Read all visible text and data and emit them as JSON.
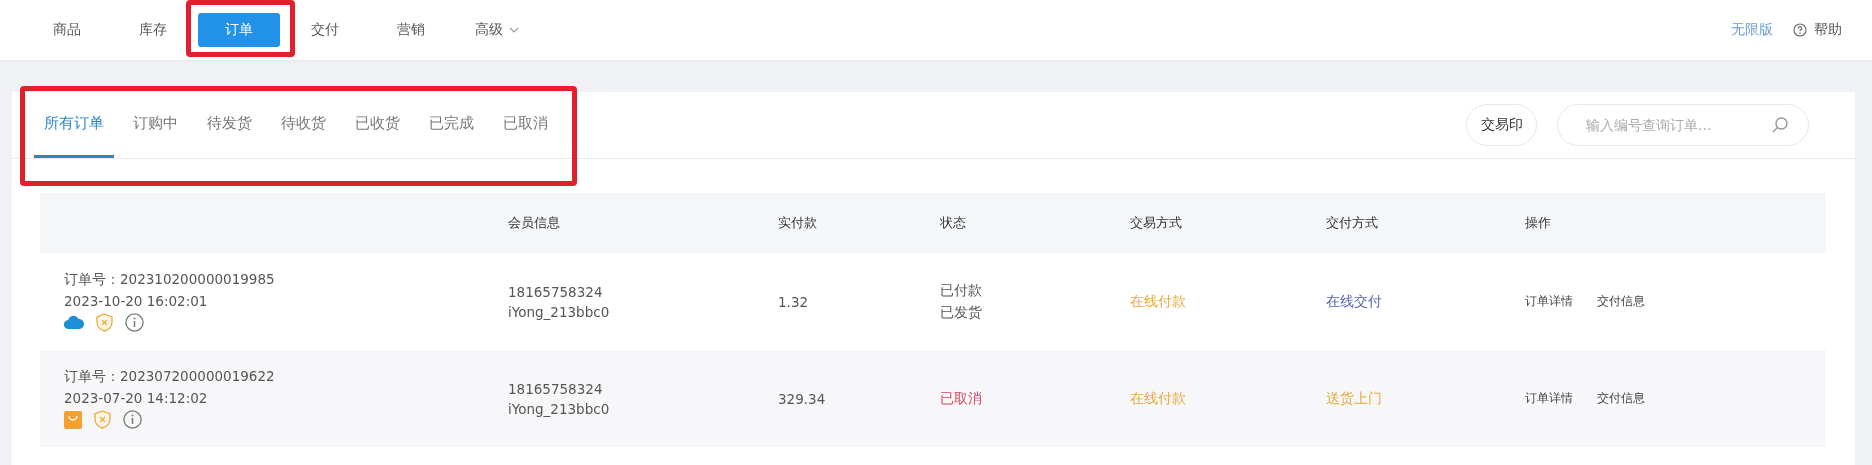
{
  "nav": {
    "items": [
      {
        "label": "商品",
        "selected": false,
        "highlighted": false,
        "dropdown": false
      },
      {
        "label": "库存",
        "selected": false,
        "highlighted": false,
        "dropdown": false
      },
      {
        "label": "订单",
        "selected": true,
        "highlighted": true,
        "dropdown": false
      },
      {
        "label": "交付",
        "selected": false,
        "highlighted": false,
        "dropdown": false
      },
      {
        "label": "营销",
        "selected": false,
        "highlighted": false,
        "dropdown": false
      },
      {
        "label": "高级",
        "selected": false,
        "highlighted": false,
        "dropdown": true
      }
    ],
    "edition": "无限版",
    "help": "帮助"
  },
  "order_tabs": {
    "highlighted": true,
    "items": [
      {
        "label": "所有订单",
        "selected": true
      },
      {
        "label": "订购中",
        "selected": false
      },
      {
        "label": "待发货",
        "selected": false
      },
      {
        "label": "待收货",
        "selected": false
      },
      {
        "label": "已收货",
        "selected": false
      },
      {
        "label": "已完成",
        "selected": false
      },
      {
        "label": "已取消",
        "selected": false
      }
    ]
  },
  "print_button": "交易印",
  "search": {
    "placeholder": "输入编号查询订单..."
  },
  "table": {
    "columns": [
      "会员信息",
      "实付款",
      "状态",
      "交易方式",
      "交付方式",
      "操作"
    ],
    "rows": [
      {
        "order_no": "订单号：202310200000019985",
        "time": "2023-10-20 16:02:01",
        "icons": [
          {
            "kind": "cloud"
          },
          {
            "kind": "shield"
          },
          {
            "kind": "info"
          }
        ],
        "member": [
          "18165758324",
          "iYong_213bbc0"
        ],
        "paid": "1.32",
        "status": {
          "lines": [
            "已付款",
            "已发货"
          ],
          "color": "#555555"
        },
        "payment": {
          "text": "在线付款",
          "color": "#e8a93a"
        },
        "delivery": {
          "text": "在线交付",
          "color": "#5a62b0"
        },
        "actions": [
          "订单详情",
          "交付信息"
        ]
      },
      {
        "order_no": "订单号：202307200000019622",
        "time": "2023-07-20 14:12:02",
        "icons": [
          {
            "kind": "bag"
          },
          {
            "kind": "shield"
          },
          {
            "kind": "info"
          }
        ],
        "member": [
          "18165758324",
          "iYong_213bbc0"
        ],
        "paid": "329.34",
        "status": {
          "lines": [
            "已取消"
          ],
          "color": "#d9455f"
        },
        "payment": {
          "text": "在线付款",
          "color": "#e8a93a"
        },
        "delivery": {
          "text": "送货上门",
          "color": "#e8a93a"
        },
        "actions": [
          "订单详情",
          "交付信息"
        ]
      }
    ]
  }
}
